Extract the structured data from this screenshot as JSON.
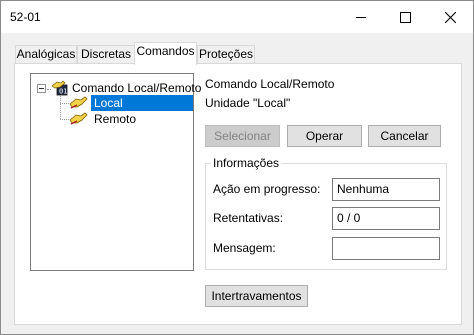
{
  "window": {
    "title": "52-01"
  },
  "tabs": [
    {
      "label": "Analógicas"
    },
    {
      "label": "Discretas"
    },
    {
      "label": "Comandos"
    },
    {
      "label": "Proteções"
    }
  ],
  "tree": {
    "root": {
      "label": "Comando Local/Remoto",
      "icon": "command-node-icon"
    },
    "children": [
      {
        "label": "Local",
        "icon": "hand-pointer-icon",
        "selected": true
      },
      {
        "label": "Remoto",
        "icon": "hand-pointer-icon",
        "selected": false
      }
    ]
  },
  "detail": {
    "command_name": "Comando Local/Remoto",
    "unit": "Unidade \"Local\""
  },
  "actions": {
    "select": "Selecionar",
    "operate": "Operar",
    "cancel": "Cancelar"
  },
  "info": {
    "group_title": "Informações",
    "progress_label": "Ação em progresso:",
    "progress_value": "Nenhuma",
    "retries_label": "Retentativas:",
    "retries_value": "0 / 0",
    "message_label": "Mensagem:",
    "message_value": ""
  },
  "interlocks_button": "Intertravamentos",
  "colors": {
    "selection": "#0078d7",
    "dialog_bg": "#f0f0f0"
  }
}
